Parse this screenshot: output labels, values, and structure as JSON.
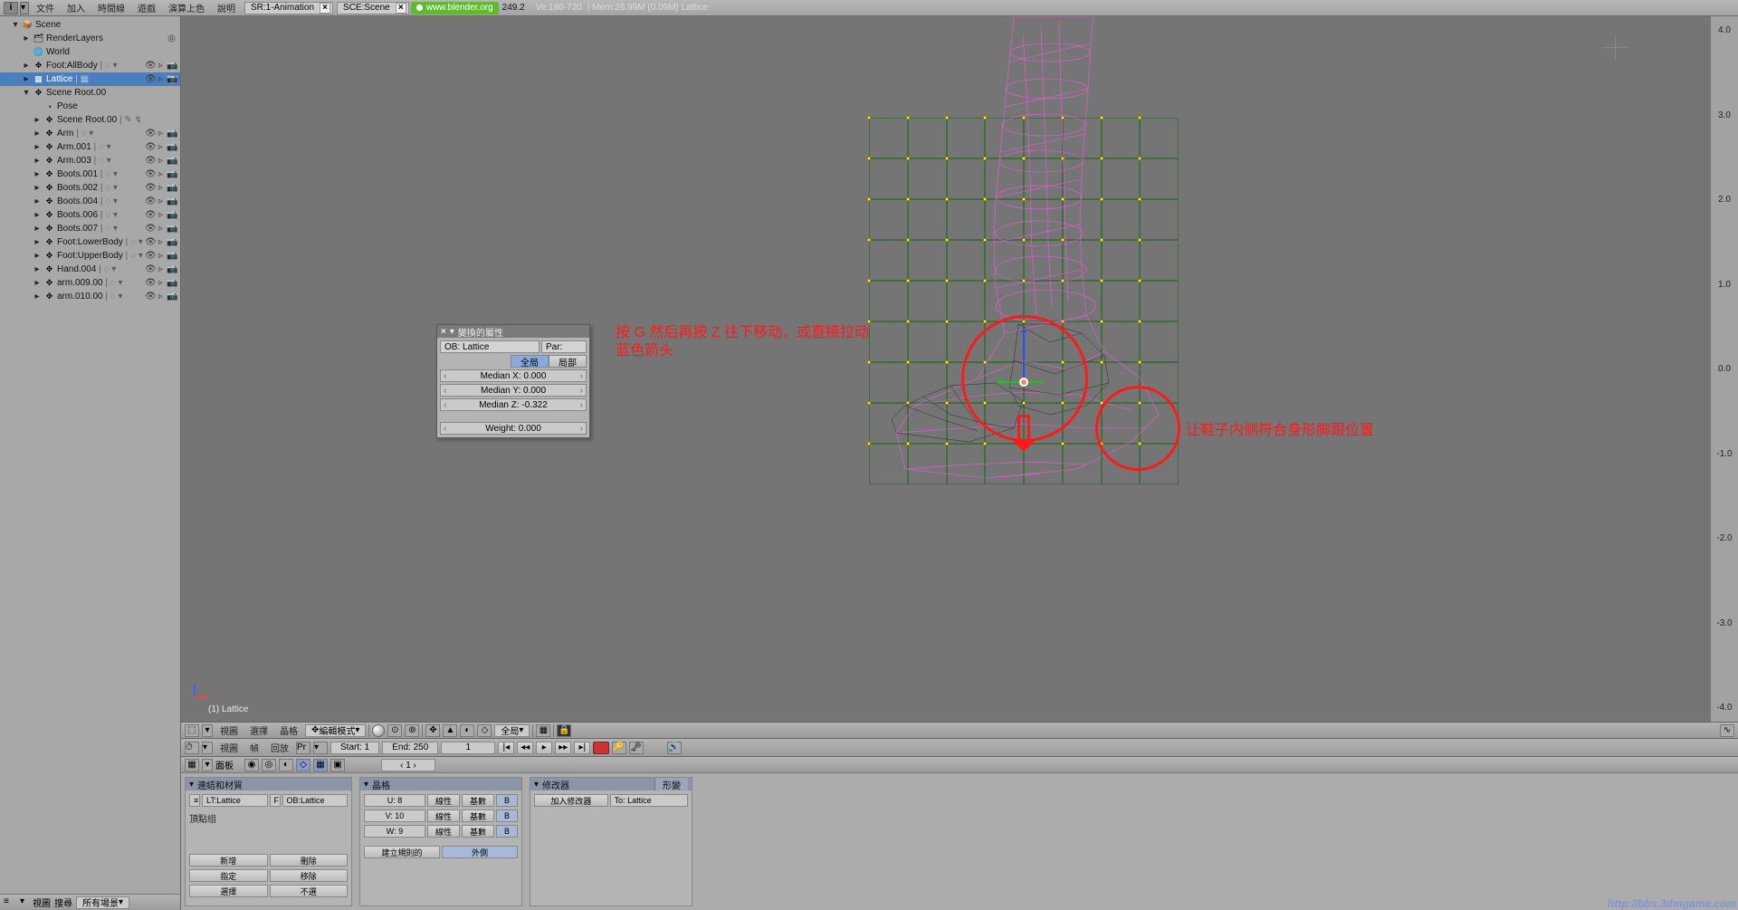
{
  "top": {
    "menus": [
      "文件",
      "加入",
      "時間線",
      "遊戲",
      "演算上色",
      "說明"
    ],
    "screen_tab": "SR:1-Animation",
    "scene_tab": "SCE:Scene",
    "url": "www.blender.org",
    "version": "249.2",
    "ve": "Ve:180-720",
    "stats": "Mem:26.99M (0.09M) Lattice"
  },
  "outliner": {
    "footer": {
      "view": "視圖",
      "search": "搜尋",
      "mode": "所有場景"
    },
    "items": [
      {
        "ind": 0,
        "tri": "▾",
        "ico": "📦",
        "name": "Scene"
      },
      {
        "ind": 1,
        "tri": "▸",
        "ico": "🗂",
        "name": "RenderLayers",
        "ric": [
          "◎"
        ]
      },
      {
        "ind": 1,
        "tri": "",
        "ico": "🌐",
        "name": "World"
      },
      {
        "ind": 1,
        "tri": "▸",
        "ico": "✥",
        "name": "Foot:AllBody",
        "ext": "| ◌ ▾",
        "ric": [
          "👁",
          "▹",
          "📷"
        ]
      },
      {
        "ind": 1,
        "tri": "▸",
        "ico": "▦",
        "name": "Lattice",
        "ext": "| ▦",
        "sel": true,
        "ric": [
          "👁",
          "▹",
          "📷"
        ]
      },
      {
        "ind": 1,
        "tri": "▾",
        "ico": "✥",
        "name": "Scene Root.00",
        "ric": []
      },
      {
        "ind": 2,
        "tri": "",
        "ico": "◔",
        "name": "Pose"
      },
      {
        "ind": 2,
        "tri": "▸",
        "ico": "✥",
        "name": "Scene Root.00",
        "ext": "| ✎ ↯"
      },
      {
        "ind": 2,
        "tri": "▸",
        "ico": "✥",
        "name": "Arm",
        "ext": "| ◌ ▾",
        "ric": [
          "👁",
          "▹",
          "📷"
        ]
      },
      {
        "ind": 2,
        "tri": "▸",
        "ico": "✥",
        "name": "Arm.001",
        "ext": "| ◌ ▾",
        "ric": [
          "👁",
          "▹",
          "📷"
        ]
      },
      {
        "ind": 2,
        "tri": "▸",
        "ico": "✥",
        "name": "Arm.003",
        "ext": "| ◌ ▾",
        "ric": [
          "👁",
          "▹",
          "📷"
        ]
      },
      {
        "ind": 2,
        "tri": "▸",
        "ico": "✥",
        "name": "Boots.001",
        "ext": "| ◌ ▾",
        "ric": [
          "👁",
          "▹",
          "📷"
        ]
      },
      {
        "ind": 2,
        "tri": "▸",
        "ico": "✥",
        "name": "Boots.002",
        "ext": "| ◌ ▾",
        "ric": [
          "👁",
          "▹",
          "📷"
        ]
      },
      {
        "ind": 2,
        "tri": "▸",
        "ico": "✥",
        "name": "Boots.004",
        "ext": "| ◌ ▾",
        "ric": [
          "👁",
          "▹",
          "📷"
        ]
      },
      {
        "ind": 2,
        "tri": "▸",
        "ico": "✥",
        "name": "Boots.006",
        "ext": "| ◌ ▾",
        "ric": [
          "👁",
          "▹",
          "📷"
        ]
      },
      {
        "ind": 2,
        "tri": "▸",
        "ico": "✥",
        "name": "Boots.007",
        "ext": "| ◌ ▾",
        "ric": [
          "👁",
          "▹",
          "📷"
        ]
      },
      {
        "ind": 2,
        "tri": "▸",
        "ico": "✥",
        "name": "Foot:LowerBody",
        "ext": "| ◌ ▾",
        "ric": [
          "👁",
          "▹",
          "📷"
        ]
      },
      {
        "ind": 2,
        "tri": "▸",
        "ico": "✥",
        "name": "Foot:UpperBody",
        "ext": "| ◌ ▾",
        "ric": [
          "👁",
          "▹",
          "📷"
        ]
      },
      {
        "ind": 2,
        "tri": "▸",
        "ico": "✥",
        "name": "Hand.004",
        "ext": "| ◌ ▾",
        "ric": [
          "👁",
          "▹",
          "📷"
        ]
      },
      {
        "ind": 2,
        "tri": "▸",
        "ico": "✥",
        "name": "arm.009.00",
        "ext": "| ◌ ▾",
        "ric": [
          "👁",
          "▹",
          "📷"
        ]
      },
      {
        "ind": 2,
        "tri": "▸",
        "ico": "✥",
        "name": "arm.010.00",
        "ext": "| ◌ ▾",
        "ric": [
          "👁",
          "▹",
          "📷"
        ]
      }
    ]
  },
  "npanel": {
    "title": "變換的屬性",
    "ob_label": "OB: Lattice",
    "par_label": "Par:",
    "global": "全局",
    "local": "局部",
    "mx": "Median X: 0.000",
    "my": "Median Y: 0.000",
    "mz": "Median Z: -0.322",
    "weight": "Weight: 0.000"
  },
  "view3d": {
    "info": "(1) Lattice",
    "ruler": [
      "4.0",
      "3.0",
      "2.0",
      "1.0",
      "0.0",
      "-1.0",
      "-2.0",
      "-3.0",
      "-4.0"
    ],
    "menus": [
      "視圖",
      "選擇",
      "晶格"
    ],
    "mode": "編輯模式",
    "orient": "全局"
  },
  "annotations": {
    "text1": "按 G 然后再按 Z 往下移动，或直接拉动蓝色箭头",
    "text2": "让鞋子内侧符合身形脚跟位置"
  },
  "timeline": {
    "menus": [
      "視圖",
      "幀",
      "回放"
    ],
    "pr": "Pr",
    "start": "Start: 1",
    "end": "End: 250",
    "frame": "1"
  },
  "buttons": {
    "hdr_panel": "面板",
    "frame": "1",
    "p1": {
      "title": "連結和材質",
      "lt": "LT:Lattice",
      "ob": "OB:Lattice",
      "f": "F",
      "vg": "頂點组",
      "b1": "新增",
      "b2": "刪除",
      "b3": "指定",
      "b4": "移除",
      "b5": "選擇",
      "b6": "不選"
    },
    "p2": {
      "title": "晶格",
      "u": "U: 8",
      "v": "V: 10",
      "w": "W: 9",
      "lin": "線性",
      "card": "基數",
      "b": "B",
      "regular": "建立規則的",
      "outside": "外側"
    },
    "p3": {
      "title": "修改器",
      "tab2": "形變",
      "add": "加入修改器",
      "to": "To: Lattice"
    }
  },
  "watermark": "http://bbs.3dmgame.com"
}
